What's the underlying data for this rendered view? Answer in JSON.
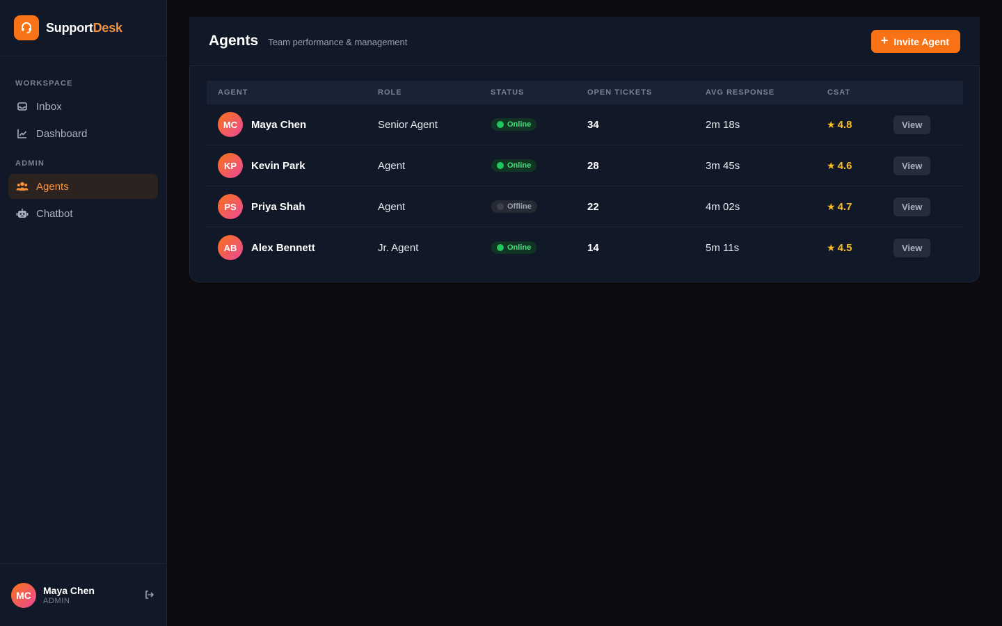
{
  "brand": {
    "name_main": "Support",
    "name_accent": "Desk"
  },
  "sidebar": {
    "workspace_label": "WORKSPACE",
    "admin_label": "ADMIN",
    "items": [
      {
        "label": "Inbox",
        "icon": "inbox-icon"
      },
      {
        "label": "Dashboard",
        "icon": "chart-line-icon"
      },
      {
        "label": "Agents",
        "icon": "users-icon",
        "active": true
      },
      {
        "label": "Chatbot",
        "icon": "robot-icon"
      }
    ],
    "user": {
      "initials": "MC",
      "name": "Maya Chen",
      "role": "ADMIN"
    }
  },
  "header": {
    "title": "Agents",
    "subtitle": "Team performance & management",
    "invite_label": "Invite Agent"
  },
  "table": {
    "columns": [
      "AGENT",
      "ROLE",
      "STATUS",
      "OPEN TICKETS",
      "AVG RESPONSE",
      "CSAT"
    ],
    "rows": [
      {
        "initials": "MC",
        "name": "Maya Chen",
        "role": "Senior Agent",
        "status": "Online",
        "tickets": "34",
        "avg": "2m 18s",
        "csat": "4.8",
        "action": "View"
      },
      {
        "initials": "KP",
        "name": "Kevin Park",
        "role": "Agent",
        "status": "Online",
        "tickets": "28",
        "avg": "3m 45s",
        "csat": "4.6",
        "action": "View"
      },
      {
        "initials": "PS",
        "name": "Priya Shah",
        "role": "Agent",
        "status": "Offline",
        "tickets": "22",
        "avg": "4m 02s",
        "csat": "4.7",
        "action": "View"
      },
      {
        "initials": "AB",
        "name": "Alex Bennett",
        "role": "Jr. Agent",
        "status": "Online",
        "tickets": "14",
        "avg": "5m 11s",
        "csat": "4.5",
        "action": "View"
      }
    ]
  },
  "colors": {
    "accent": "#f97316",
    "online": "#22c55e",
    "star": "#fbbf24",
    "background": "#0b0b10",
    "panel": "#111827"
  }
}
